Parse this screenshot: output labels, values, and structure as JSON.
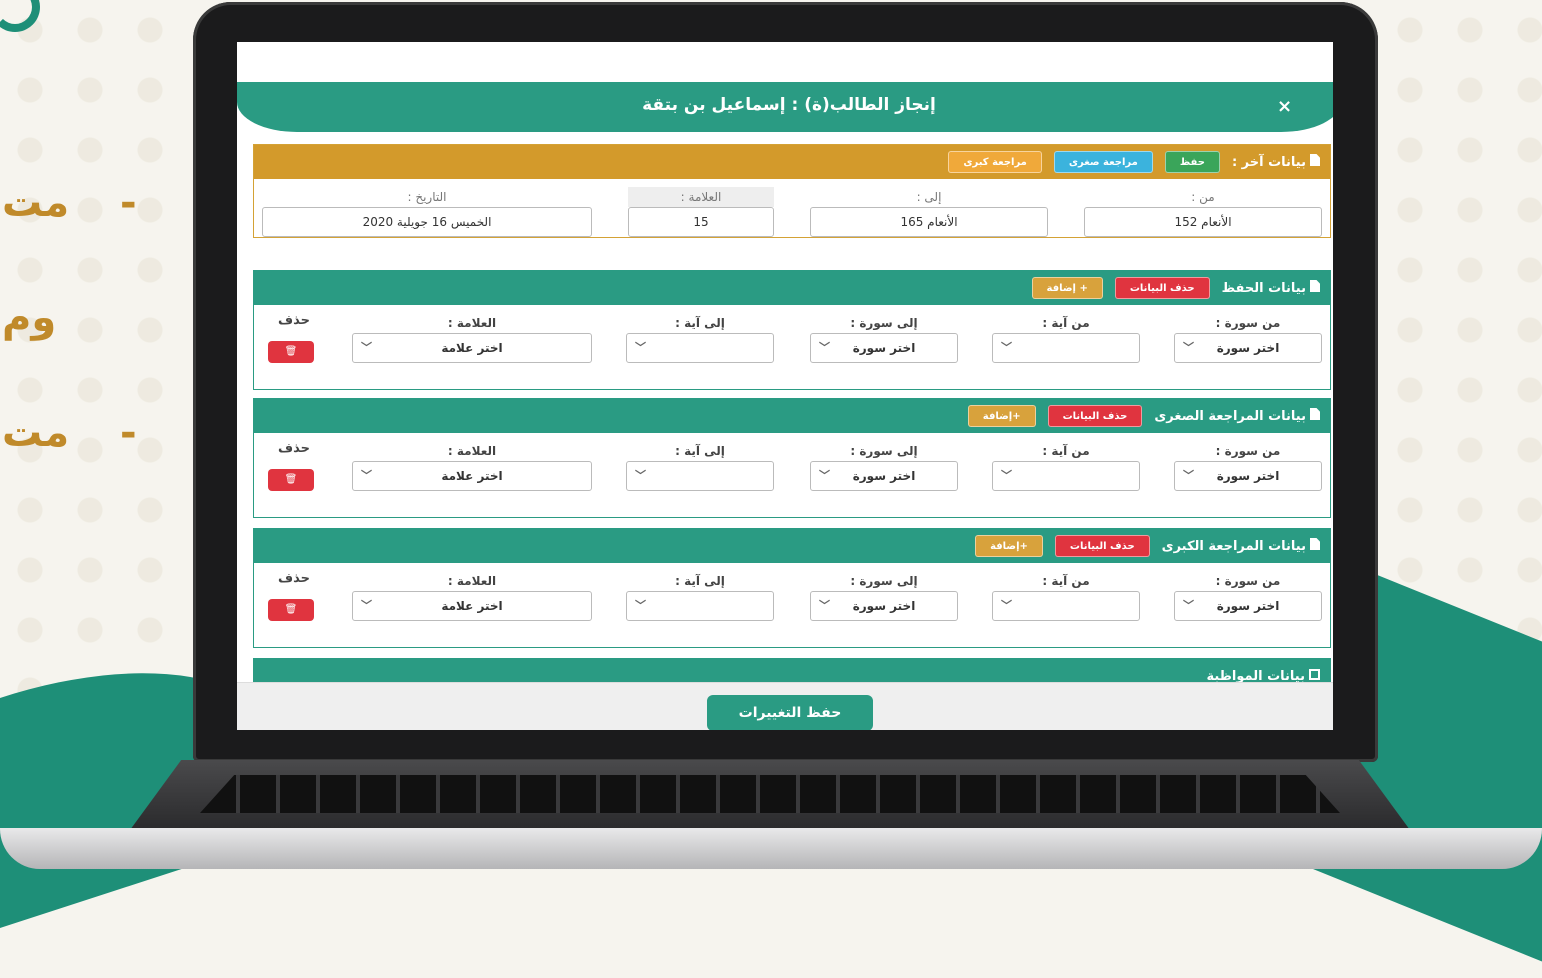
{
  "side": {
    "line1": "مت",
    "line2": "وم",
    "line3": "مت",
    "dash": "-"
  },
  "modal": {
    "title": "إنجاز الطالب(ة) : إسماعيل بن بتقة",
    "close": "×",
    "save_changes": "حفظ التغييرات"
  },
  "other": {
    "title": "بيانات آخر :",
    "buttons": [
      "حفظ",
      "مراجعة صغرى",
      "مراجعة كبرى"
    ],
    "fields": [
      {
        "label": "من :",
        "value": "الأنعام 152"
      },
      {
        "label": "إلى :",
        "value": "الأنعام 165"
      },
      {
        "label": "العلامة :",
        "value": "15"
      },
      {
        "label": "التاريخ :",
        "value": "الخميس 16 جويلية 2020"
      }
    ]
  },
  "sections": [
    {
      "title": "بيانات الحفظ",
      "delete_data": "حذف البيانات",
      "add": "+ إضافة"
    },
    {
      "title": "بيانات المراجعة الصغرى",
      "delete_data": "حذف البيانات",
      "add": "+إضافة"
    },
    {
      "title": "بيانات المراجعة الكبرى",
      "delete_data": "حذف البيانات",
      "add": "+إضافة"
    }
  ],
  "row_labels": {
    "from_surah": "من سورة :",
    "from_ayah": "من آية :",
    "to_surah": "إلى سورة :",
    "to_ayah": "إلى آية :",
    "grade": "العلامة :",
    "delete": "حذف"
  },
  "row_values": {
    "choose_surah": "اختر سورة",
    "choose_grade": "اختر علامة",
    "chevron": "﹀",
    "trash": "🗑"
  },
  "attendance": {
    "title": "بيانات المواظبة"
  },
  "colors": {
    "primary": "#2a9b83",
    "accent": "#d39a2b",
    "danger": "#e0343f"
  }
}
